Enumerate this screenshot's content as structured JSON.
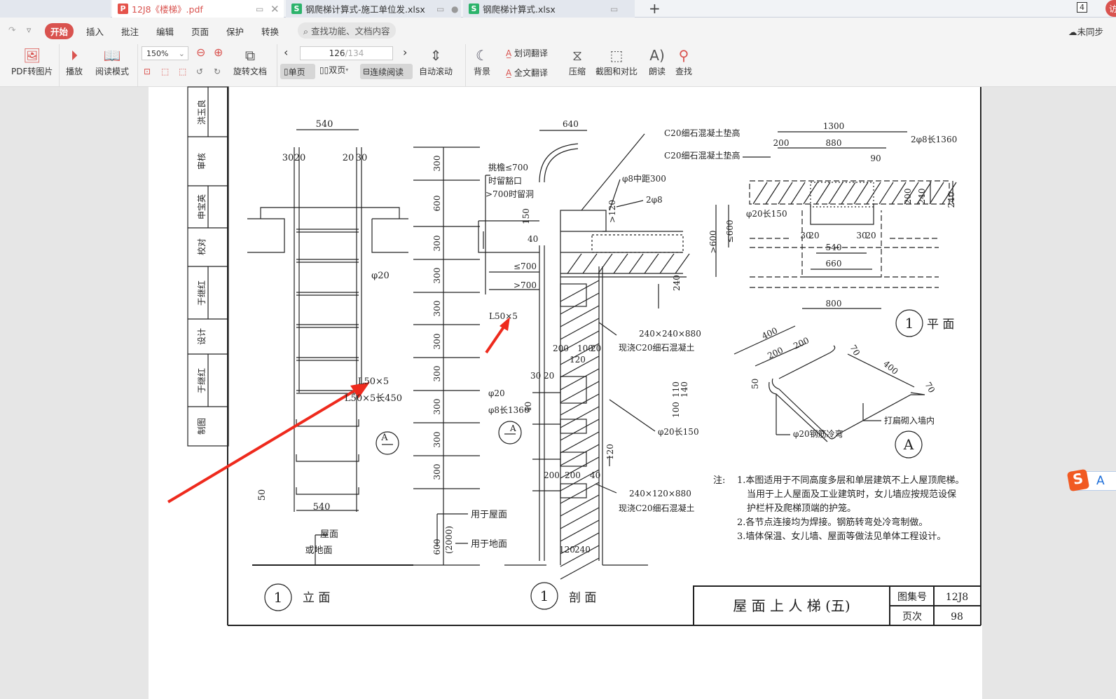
{
  "tabs": [
    {
      "label": "12J8《楼梯》.pdf",
      "icon": "pdf-icon",
      "active": true
    },
    {
      "label": "钢爬梯计算式-施工单位发.xlsx",
      "icon": "spreadsheet-icon",
      "active": false
    },
    {
      "label": "钢爬梯计算式.xlsx",
      "icon": "spreadsheet-icon",
      "active": false
    }
  ],
  "window": {
    "badge": "4",
    "user_initial": "访"
  },
  "menu": {
    "items": [
      "开始",
      "插入",
      "批注",
      "编辑",
      "页面",
      "保护",
      "转换"
    ],
    "active": "开始",
    "search_placeholder": "查找功能、文档内容",
    "sync": "未同步"
  },
  "toolbar": {
    "pdf_to_image": "PDF转图片",
    "play": "播放",
    "read_mode": "阅读模式",
    "zoom": "150%",
    "rotate": "旋转文档",
    "page_current": "126",
    "page_total": "/134",
    "single": "单页",
    "double": "双页",
    "continuous": "连续阅读",
    "auto_scroll": "自动滚动",
    "background": "背景",
    "word_translate": "划词翻译",
    "full_translate": "全文翻译",
    "compress": "压缩",
    "screenshot_compare": "截图和对比",
    "read_aloud": "朗读",
    "find": "查找"
  },
  "ime": {
    "label": "A"
  },
  "colors": {
    "accent": "#d9534f",
    "arrow": "#ee2a1d",
    "active_tab_text": "#d9534f"
  },
  "drawing": {
    "signatures": [
      "洪玉良",
      "审核",
      "申宝英",
      "校对",
      "于继红",
      "设计",
      "于继红",
      "制图"
    ],
    "elevation": {
      "title_num": "1",
      "title": "立  面",
      "labels": [
        "540",
        "30",
        "20",
        "20",
        "30",
        "φ20",
        "L50×5",
        "L50×5长450",
        "A",
        "540",
        "50",
        "屋面",
        "或地面"
      ],
      "dims": [
        "300",
        "600",
        "300",
        "300",
        "300",
        "300",
        "300",
        "300",
        "300",
        "300",
        "600",
        "(2000)"
      ],
      "dim_notes": [
        "用于屋面",
        "用于地面"
      ]
    },
    "section": {
      "title_num": "1",
      "title": "剖  面",
      "labels": [
        "640",
        "挑檐≤700",
        "时留豁口",
        ">700时留洞",
        "150",
        "40",
        "≤700",
        ">700",
        "L50×5",
        "C20细石混凝土垫高",
        "C20细石混凝土垫高",
        "φ8中距300",
        "2φ8",
        ">120",
        "240",
        "240×240×880",
        "现浇C20细石混凝土",
        "200",
        "100",
        "20",
        "120",
        "30",
        "20",
        "φ20",
        "φ8长1360",
        "A",
        "φ20长150",
        "40",
        "110",
        "100",
        "140",
        "120",
        "200",
        "200",
        "40",
        "240×120×880",
        "现浇C20细石混凝土",
        "120",
        "240"
      ]
    },
    "plan": {
      "title_num": "1",
      "title": "平  面",
      "labels": [
        "1300",
        "200",
        "880",
        "90",
        "2φ8长1360",
        "φ20长150",
        "240",
        "240",
        "200",
        ">600",
        "≤600",
        "30",
        "20",
        "30",
        "20",
        "540",
        "660",
        "800"
      ]
    },
    "detail_a": {
      "title": "A",
      "labels": [
        "400",
        "200",
        "200",
        "70",
        "400",
        "70",
        "50",
        "φ20钢筋冷弯",
        "打扁砌入墙内"
      ]
    },
    "notes": {
      "label": "注:",
      "lines": [
        "1.本图适用于不同高度多层和单层建筑不上人屋顶爬梯。",
        "当用于上人屋面及工业建筑时，女儿墙应按规范设保",
        "护栏杆及爬梯顶端的护笼。",
        "2.各节点连接均为焊接。钢筋转弯处冷弯制做。",
        "3.墙体保温、女儿墙、屋面等做法见单体工程设计。"
      ]
    },
    "title_block": {
      "title": "屋 面 上 人 梯 (五)",
      "atlas_label": "图集号",
      "atlas": "12J8",
      "page_label": "页次",
      "page": "98"
    }
  }
}
